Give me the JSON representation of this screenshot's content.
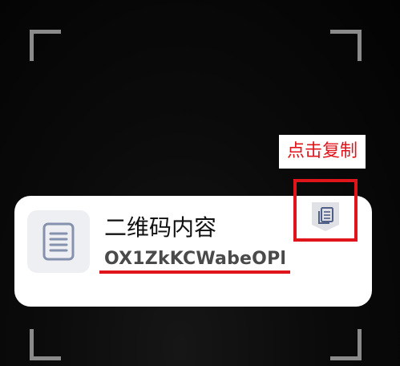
{
  "scan_frame": {
    "corner_color": "#8b8b8b"
  },
  "result_card": {
    "title": "二维码内容",
    "content": "OX1ZkKCWabeOPl",
    "doc_icon": "document-icon",
    "copy_icon": "copy-icon"
  },
  "annotation": {
    "label": "点击复制",
    "color": "#e0141b"
  }
}
